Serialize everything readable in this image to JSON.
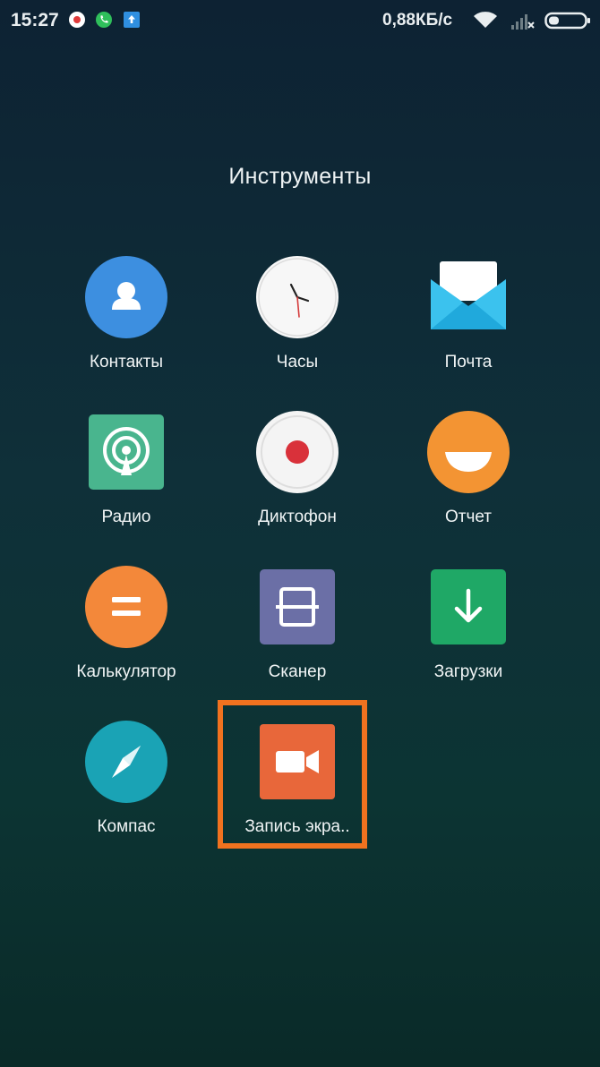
{
  "status_bar": {
    "time": "15:27",
    "speed": "0,88КБ/с",
    "icons": [
      "record-notification-icon",
      "phone-icon",
      "upload-icon",
      "wifi-icon",
      "signal-icon",
      "battery-icon"
    ]
  },
  "folder": {
    "title": "Инструменты"
  },
  "apps": [
    {
      "label": "Контакты",
      "icon": "contacts-icon",
      "color": "#3d8fe0"
    },
    {
      "label": "Часы",
      "icon": "clock-icon",
      "color": "#f7f7f7"
    },
    {
      "label": "Почта",
      "icon": "mail-icon",
      "color": "#29b6e6"
    },
    {
      "label": "Радио",
      "icon": "radio-icon",
      "color": "#49b58e"
    },
    {
      "label": "Диктофон",
      "icon": "recorder-icon",
      "color": "#f4f4f4"
    },
    {
      "label": "Отчет",
      "icon": "feedback-icon",
      "color": "#f39433"
    },
    {
      "label": "Калькулятор",
      "icon": "calculator-icon",
      "color": "#f3883a"
    },
    {
      "label": "Сканер",
      "icon": "scanner-icon",
      "color": "#6b6fa6"
    },
    {
      "label": "Загрузки",
      "icon": "downloads-icon",
      "color": "#1fa866"
    },
    {
      "label": "Компас",
      "icon": "compass-icon",
      "color": "#1aa3b5"
    },
    {
      "label": "Запись экра..",
      "icon": "screen-recorder-icon",
      "color": "#e8673a"
    }
  ],
  "highlight_color": "#f1721f"
}
